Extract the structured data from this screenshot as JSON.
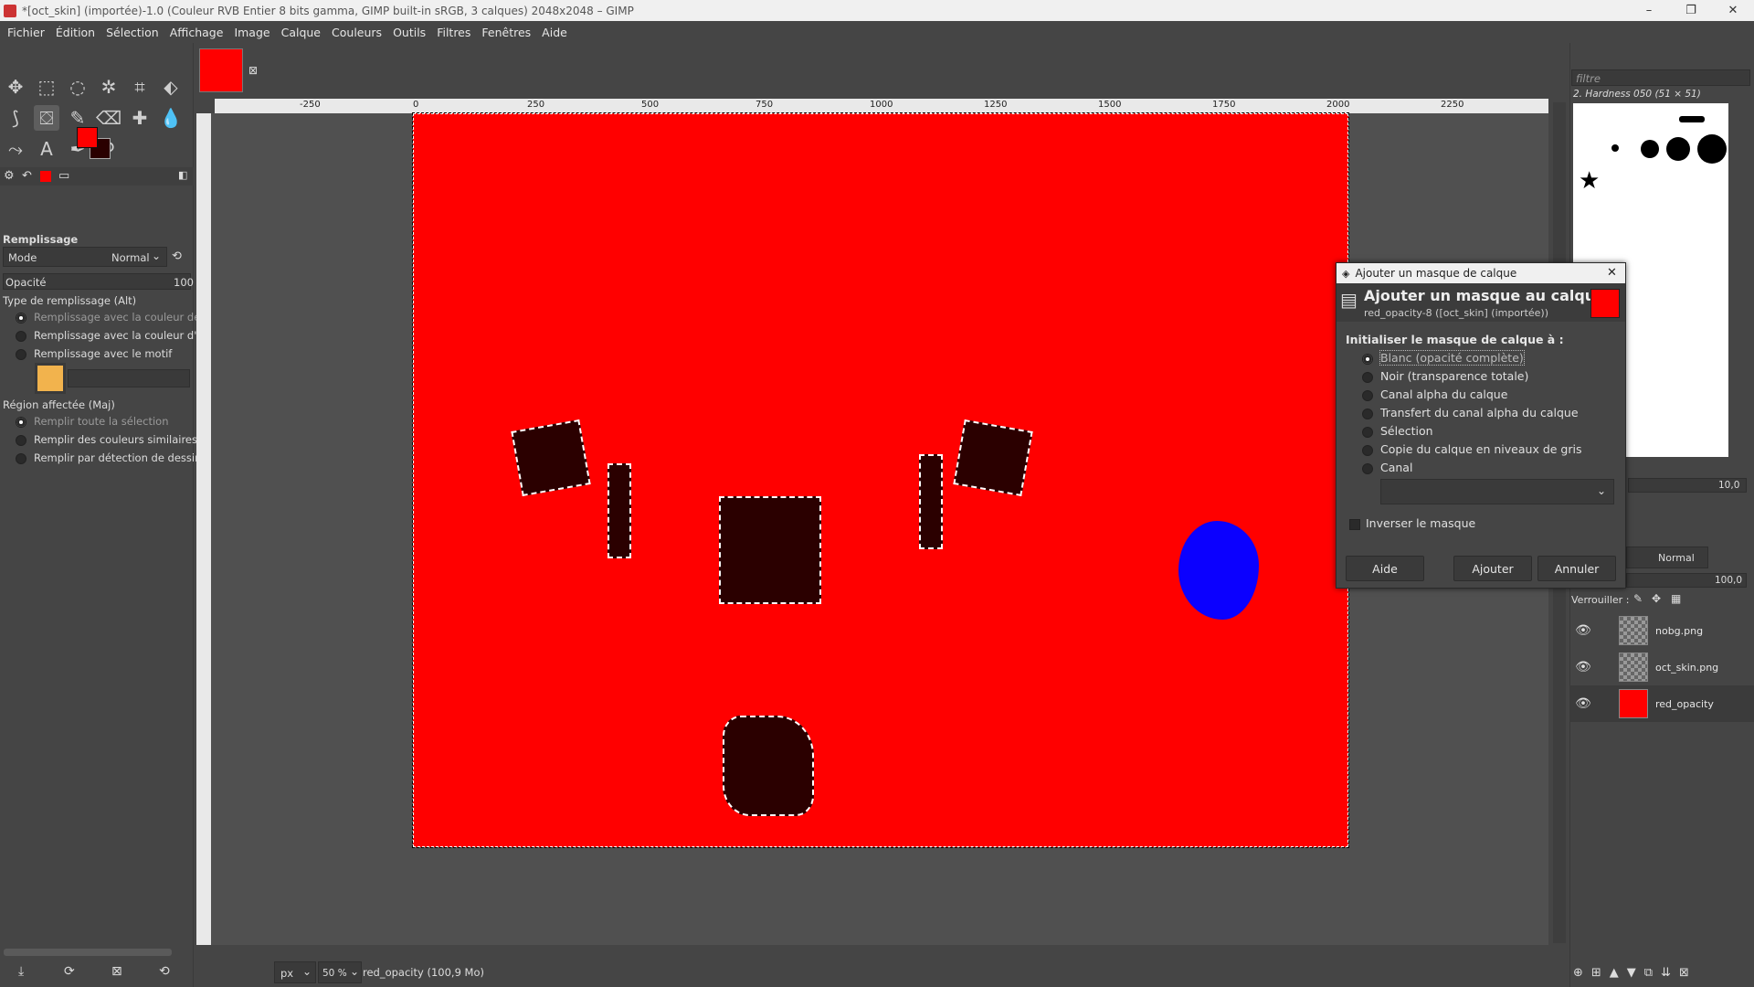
{
  "window": {
    "title": "*[oct_skin] (importée)-1.0 (Couleur RVB Entier 8 bits gamma, GIMP built-in sRGB, 3 calques) 2048x2048 – GIMP",
    "min_glyph": "–",
    "max_glyph": "❐",
    "close_glyph": "✕"
  },
  "menu": [
    "Fichier",
    "Édition",
    "Sélection",
    "Affichage",
    "Image",
    "Calque",
    "Couleurs",
    "Outils",
    "Filtres",
    "Fenêtres",
    "Aide"
  ],
  "tool_options": {
    "title": "Remplissage",
    "mode_label": "Mode",
    "mode_value": "Normal",
    "opacity_label": "Opacité",
    "opacity_value": "100",
    "fill_type_label": "Type de remplissage  (Alt)",
    "fill_types": [
      "Remplissage avec la couleur de PP",
      "Remplissage avec la couleur d'AP",
      "Remplissage avec le motif"
    ],
    "region_label": "Région affectée  (Maj)",
    "regions": [
      "Remplir toute la sélection",
      "Remplir des couleurs similaires",
      "Remplir par détection de dessin au"
    ]
  },
  "rulers": {
    "h_ticks": [
      "-250",
      "0",
      "250",
      "500",
      "750",
      "1000",
      "1250",
      "1500",
      "1750",
      "2000",
      "2250"
    ]
  },
  "statusbar": {
    "unit": "px",
    "zoom": "50 %",
    "info": "red_opacity (100,9 Mo)"
  },
  "brushes": {
    "filter_placeholder": "filtre",
    "selected_name": "2. Hardness 050 (51 × 51)",
    "spacing_value": "10,0"
  },
  "layers": {
    "mode_value": "Normal",
    "opacity_value": "100,0",
    "lock_label": "Verrouiller :",
    "items": [
      {
        "name": "nobg.png"
      },
      {
        "name": "oct_skin.png"
      },
      {
        "name": "red_opacity"
      }
    ]
  },
  "dialog": {
    "window_title": "Ajouter un masque de calque",
    "heading": "Ajouter un masque au calque",
    "subheading": "red_opacity-8 ([oct_skin] (importée))",
    "section_label": "Initialiser le masque de calque à :",
    "options": [
      "Blanc (opacité complète)",
      "Noir (transparence totale)",
      "Canal alpha du calque",
      "Transfert du canal alpha du calque",
      "Sélection",
      "Copie du calque en niveaux de gris",
      "Canal"
    ],
    "selected_index": 0,
    "invert_label": "Inverser le masque",
    "buttons": {
      "help": "Aide",
      "add": "Ajouter",
      "cancel": "Annuler"
    }
  },
  "colors": {
    "foreground": "#ff0000",
    "background": "#2a0000",
    "canvas_fill": "#ff0000",
    "blob": "#0b00ff"
  }
}
